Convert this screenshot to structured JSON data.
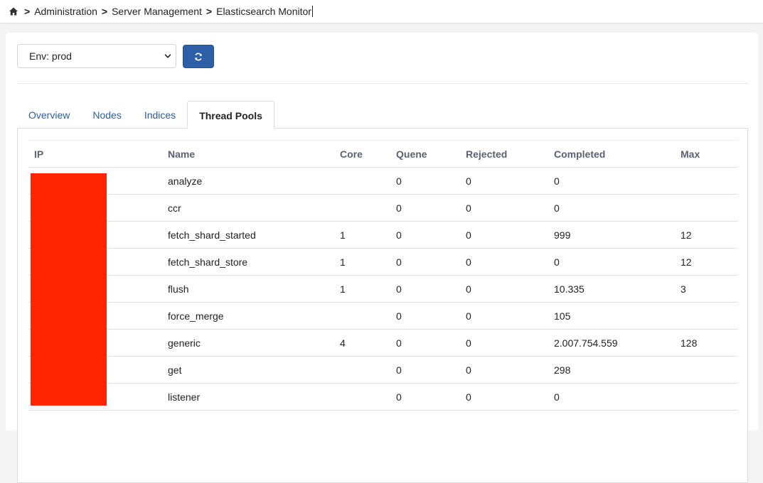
{
  "breadcrumb": {
    "home_icon": "home-icon",
    "separator": ">",
    "items": [
      "Administration",
      "Server Management",
      "Elasticsearch Monitor"
    ]
  },
  "toolbar": {
    "env_select_value": "Env: prod",
    "refresh_icon": "refresh-icon",
    "accent_color": "#2d5fa8"
  },
  "tabs": [
    {
      "label": "Overview",
      "active": false
    },
    {
      "label": "Nodes",
      "active": false
    },
    {
      "label": "Indices",
      "active": false
    },
    {
      "label": "Thread Pools",
      "active": true
    }
  ],
  "table": {
    "columns": [
      "IP",
      "Name",
      "Core",
      "Quene",
      "Rejected",
      "Completed",
      "Max"
    ],
    "rows": [
      {
        "ip": "",
        "name": "analyze",
        "core": "",
        "queue": "0",
        "rejected": "0",
        "completed": "0",
        "max": ""
      },
      {
        "ip": "",
        "name": "ccr",
        "core": "",
        "queue": "0",
        "rejected": "0",
        "completed": "0",
        "max": ""
      },
      {
        "ip": "",
        "name": "fetch_shard_started",
        "core": "1",
        "queue": "0",
        "rejected": "0",
        "completed": "999",
        "max": "12"
      },
      {
        "ip": "",
        "name": "fetch_shard_store",
        "core": "1",
        "queue": "0",
        "rejected": "0",
        "completed": "0",
        "max": "12"
      },
      {
        "ip": "",
        "name": "flush",
        "core": "1",
        "queue": "0",
        "rejected": "0",
        "completed": "10.335",
        "max": "3"
      },
      {
        "ip": "",
        "name": "force_merge",
        "core": "",
        "queue": "0",
        "rejected": "0",
        "completed": "105",
        "max": ""
      },
      {
        "ip": "",
        "name": "generic",
        "core": "4",
        "queue": "0",
        "rejected": "0",
        "completed": "2.007.754.559",
        "max": "128"
      },
      {
        "ip": "",
        "name": "get",
        "core": "",
        "queue": "0",
        "rejected": "0",
        "completed": "298",
        "max": ""
      },
      {
        "ip": "",
        "name": "listener",
        "core": "",
        "queue": "0",
        "rejected": "0",
        "completed": "0",
        "max": ""
      }
    ],
    "redaction_color": "#ff2500"
  }
}
